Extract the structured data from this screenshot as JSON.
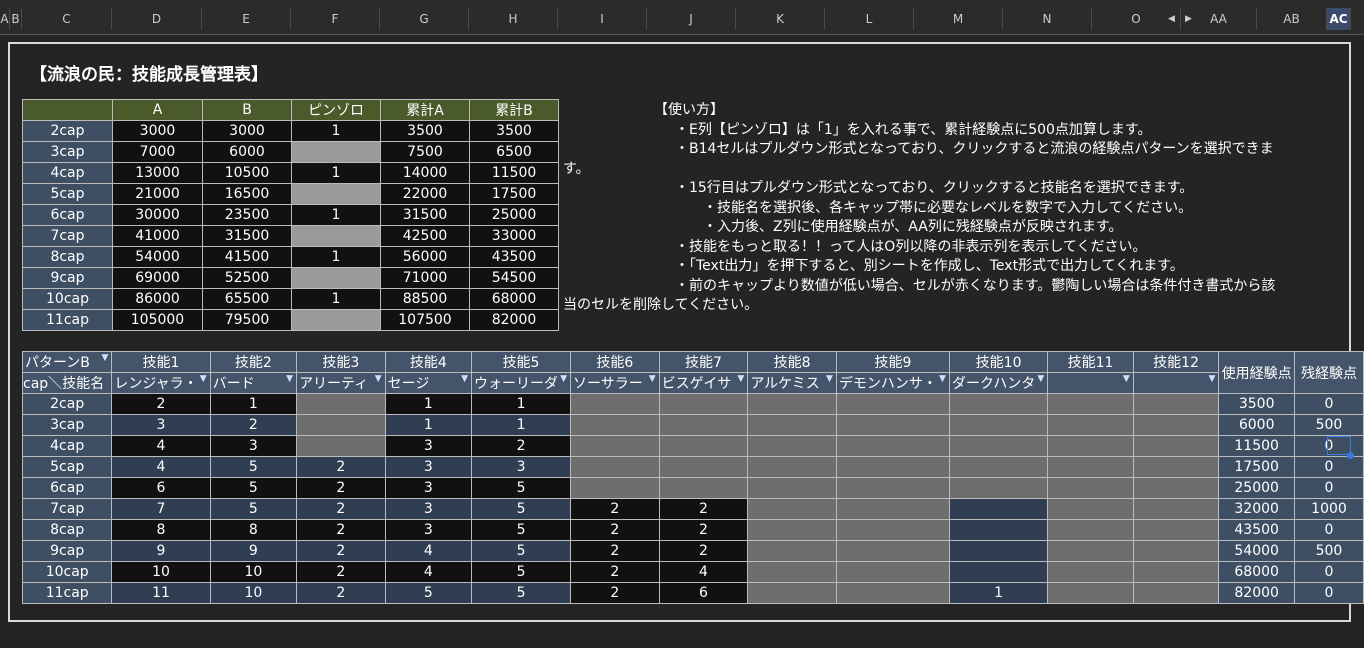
{
  "column_headers": [
    "A",
    "B",
    "C",
    "D",
    "E",
    "F",
    "G",
    "H",
    "I",
    "J",
    "K",
    "L",
    "M",
    "N",
    "O",
    "AA",
    "AB",
    "AC"
  ],
  "selected_column": "AC",
  "title": "【流浪の民：技能成長管理表】",
  "exp_table": {
    "headers": [
      "",
      "A",
      "B",
      "ピンゾロ",
      "累計A",
      "累計B"
    ],
    "rows": [
      [
        "2cap",
        "3000",
        "3000",
        "1",
        "3500",
        "3500"
      ],
      [
        "3cap",
        "7000",
        "6000",
        "",
        "7500",
        "6500"
      ],
      [
        "4cap",
        "13000",
        "10500",
        "1",
        "14000",
        "11500"
      ],
      [
        "5cap",
        "21000",
        "16500",
        "",
        "22000",
        "17500"
      ],
      [
        "6cap",
        "30000",
        "23500",
        "1",
        "31500",
        "25000"
      ],
      [
        "7cap",
        "41000",
        "31500",
        "",
        "42500",
        "33000"
      ],
      [
        "8cap",
        "54000",
        "41500",
        "1",
        "56000",
        "43500"
      ],
      [
        "9cap",
        "69000",
        "52500",
        "",
        "71000",
        "54500"
      ],
      [
        "10cap",
        "86000",
        "65500",
        "1",
        "88500",
        "68000"
      ],
      [
        "11cap",
        "105000",
        "79500",
        "",
        "107500",
        "82000"
      ]
    ]
  },
  "usage": {
    "lines": [
      "　　　　　　　【使い方】",
      "　　　　　　　　・E列【ピンゾロ】は「1」を入れる事で、累計経験点に500点加算します。",
      "　　　　　　　　・B14セルはプルダウン形式となっており、クリックすると流浪の経験点パターンを選択できま",
      "す。",
      "　　　　　　　　・15行目はプルダウン形式となっており、クリックすると技能名を選択できます。",
      "　　　　　　　　　　・技能名を選択後、各キャップ帯に必要なレベルを数字で入力してください。",
      "　　　　　　　　　　・入力後、Z列に使用経験点が、AA列に残経験点が反映されます。",
      "　　　　　　　　・技能をもっと取る！！って人はO列以降の非表示列を表示してください。",
      "　　　　　　　　・「Text出力」を押下すると、別シートを作成し、Text形式で出力してくれます。",
      "　　　　　　　　・前のキャップより数値が低い場合、セルが赤くなります。鬱陶しい場合は条件付き書式から該",
      "当のセルを削除してください。"
    ]
  },
  "skill_table": {
    "pattern_label": "パターンB",
    "cap_label": "cap＼技能名",
    "skill_headers": [
      "技能1",
      "技能2",
      "技能3",
      "技能4",
      "技能5",
      "技能6",
      "技能7",
      "技能8",
      "技能9",
      "技能10",
      "技能11",
      "技能12"
    ],
    "skill_names": [
      "レンジャラ・",
      "バード",
      "アリーティ",
      "セージ",
      "ウォーリーダ",
      "ソーサラー",
      "ビスゲイサ",
      "アルケミス",
      "デモンハンサ・",
      "ダークハンタ",
      "",
      ""
    ],
    "used_header": "使用経験点",
    "remain_header": "残経験点",
    "rows": [
      {
        "cap": "2cap",
        "vals": [
          "2",
          "1",
          "",
          "1",
          "1",
          "",
          "",
          "",
          "",
          "",
          "",
          ""
        ],
        "used": "3500",
        "remain": "0"
      },
      {
        "cap": "3cap",
        "vals": [
          "3",
          "2",
          "",
          "1",
          "1",
          "",
          "",
          "",
          "",
          "",
          "",
          ""
        ],
        "used": "6000",
        "remain": "500"
      },
      {
        "cap": "4cap",
        "vals": [
          "4",
          "3",
          "",
          "3",
          "2",
          "",
          "",
          "",
          "",
          "",
          "",
          ""
        ],
        "used": "11500",
        "remain": "0"
      },
      {
        "cap": "5cap",
        "vals": [
          "4",
          "5",
          "2",
          "3",
          "3",
          "",
          "",
          "",
          "",
          "",
          "",
          ""
        ],
        "used": "17500",
        "remain": "0"
      },
      {
        "cap": "6cap",
        "vals": [
          "6",
          "5",
          "2",
          "3",
          "5",
          "",
          "",
          "",
          "",
          "",
          "",
          ""
        ],
        "used": "25000",
        "remain": "0"
      },
      {
        "cap": "7cap",
        "vals": [
          "7",
          "5",
          "2",
          "3",
          "5",
          "2",
          "2",
          "",
          "",
          "",
          "",
          ""
        ],
        "used": "32000",
        "remain": "1000"
      },
      {
        "cap": "8cap",
        "vals": [
          "8",
          "8",
          "2",
          "3",
          "5",
          "2",
          "2",
          "",
          "",
          "",
          "",
          ""
        ],
        "used": "43500",
        "remain": "0"
      },
      {
        "cap": "9cap",
        "vals": [
          "9",
          "9",
          "2",
          "4",
          "5",
          "2",
          "2",
          "",
          "",
          "",
          "",
          ""
        ],
        "used": "54000",
        "remain": "500"
      },
      {
        "cap": "10cap",
        "vals": [
          "10",
          "10",
          "2",
          "4",
          "5",
          "2",
          "4",
          "",
          "",
          "",
          "",
          ""
        ],
        "used": "68000",
        "remain": "0"
      },
      {
        "cap": "11cap",
        "vals": [
          "11",
          "10",
          "2",
          "5",
          "5",
          "2",
          "6",
          "",
          "",
          "1",
          "",
          ""
        ],
        "used": "82000",
        "remain": "0"
      }
    ]
  }
}
